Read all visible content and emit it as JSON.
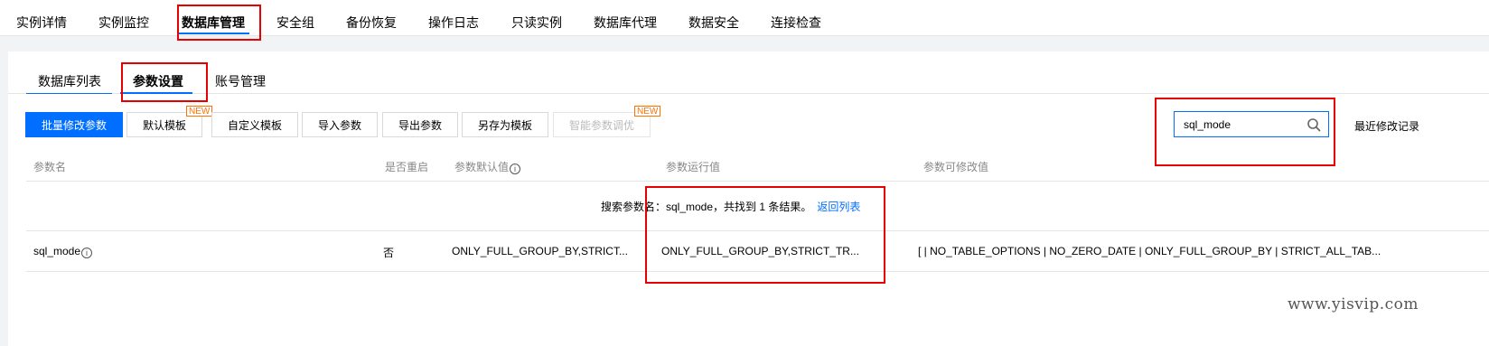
{
  "top_nav": {
    "tabs": [
      {
        "label": "实例详情"
      },
      {
        "label": "实例监控"
      },
      {
        "label": "数据库管理",
        "active": true
      },
      {
        "label": "安全组"
      },
      {
        "label": "备份恢复"
      },
      {
        "label": "操作日志"
      },
      {
        "label": "只读实例"
      },
      {
        "label": "数据库代理"
      },
      {
        "label": "数据安全"
      },
      {
        "label": "连接检查"
      }
    ]
  },
  "sub_tabs": [
    {
      "label": "数据库列表"
    },
    {
      "label": "参数设置",
      "active": true
    },
    {
      "label": "账号管理"
    }
  ],
  "toolbar": {
    "batch_modify": "批量修改参数",
    "default_template": "默认模板",
    "custom_template": "自定义模板",
    "import_params": "导入参数",
    "export_params": "导出参数",
    "save_as_template": "另存为模板",
    "smart_tuning": "智能参数调优",
    "new_badge": "NEW"
  },
  "search": {
    "value": "sql_mode",
    "icon": "search-icon"
  },
  "recent_changes": "最近修改记录",
  "table": {
    "columns": [
      "参数名",
      "是否重启",
      "参数默认值",
      "参数运行值",
      "参数可修改值"
    ],
    "notice": {
      "text": "搜索参数名：sql_mode，共找到 1 条结果。",
      "link": "返回列表"
    },
    "rows": [
      {
        "name": "sql_mode",
        "restart": "否",
        "default": "ONLY_FULL_GROUP_BY,STRICT...",
        "running": "ONLY_FULL_GROUP_BY,STRICT_TR...",
        "modifiable": "[ | NO_TABLE_OPTIONS | NO_ZERO_DATE | ONLY_FULL_GROUP_BY | STRICT_ALL_TAB..."
      }
    ]
  },
  "watermark": "www.yisvip.com",
  "colors": {
    "accent": "#006eff",
    "highlight_box": "#e60000",
    "new_badge": "#ff7200"
  }
}
